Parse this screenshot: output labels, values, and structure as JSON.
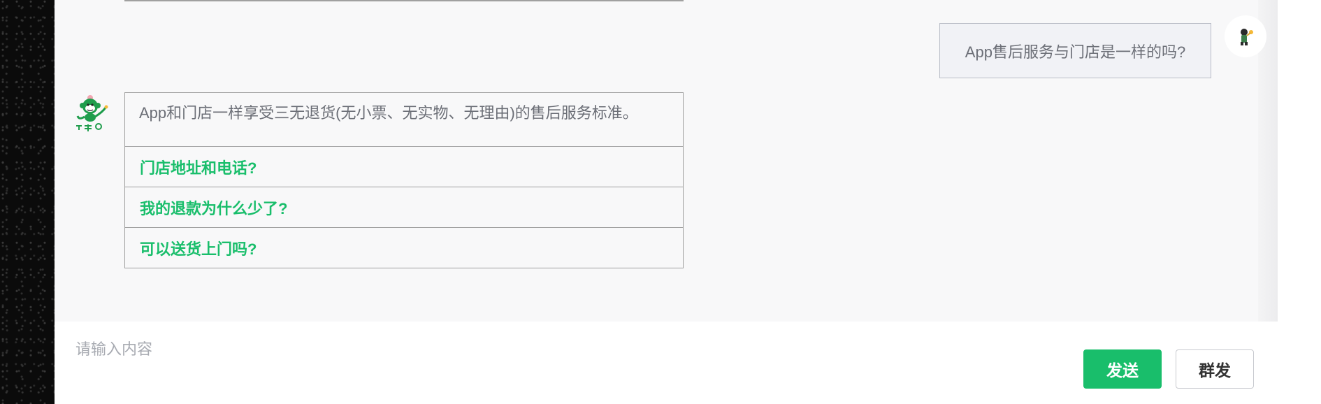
{
  "conversation": {
    "user_message": {
      "text": "App售后服务与门店是一样的吗?",
      "avatar_icon": "user-avatar-icon"
    },
    "bot_message": {
      "avatar_icon": "monkey-logo-icon",
      "answer": "App和门店一样享受三无退货(无小票、无实物、无理由)的售后服务标准。",
      "suggestions": [
        "门店地址和电话?",
        "我的退款为什么少了?",
        "可以送货上门吗?"
      ]
    }
  },
  "input": {
    "placeholder": "请输入内容",
    "value": ""
  },
  "actions": {
    "send_label": "发送",
    "broadcast_label": "群发"
  },
  "colors": {
    "accent": "#19be6b",
    "chat_background": "#f8f8f9",
    "bubble_border": "#a0a0a0"
  }
}
